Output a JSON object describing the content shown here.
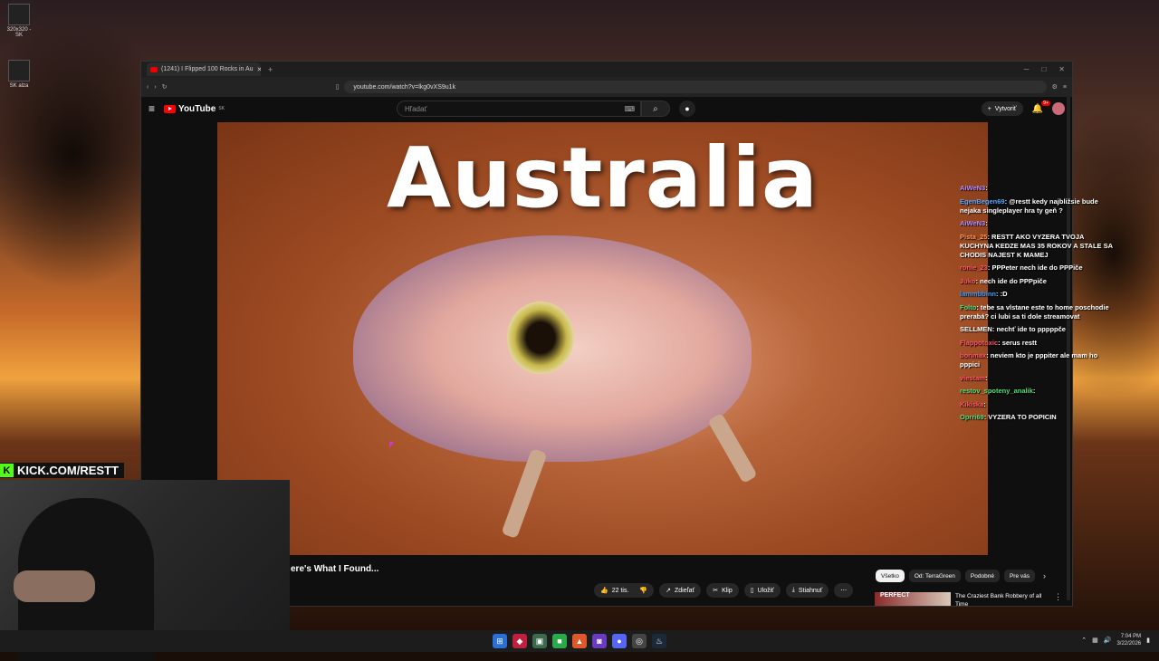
{
  "desktop": {
    "icons": [
      {
        "label": "320x320 - SK",
        "icon": "app-icon"
      },
      {
        "label": "SK alza",
        "icon": "app-icon"
      }
    ]
  },
  "browser": {
    "tab_title": "(1241) I Flipped 100 Rocks in Au",
    "url": "youtube.com/watch?v=lkg0vXS9u1k"
  },
  "youtube": {
    "logo": "YouTube",
    "country": "SK",
    "search_placeholder": "Hľadať",
    "create_label": "Vytvoriť",
    "notifications": "9+",
    "video_overlay_title": "Australia",
    "video_heading": "ere's What I Found...",
    "actions": {
      "like": "22 tis.",
      "share": "Zdieľať",
      "clip": "Klip",
      "save": "Uložiť",
      "download": "Stiahnuť"
    },
    "chips": [
      "Všetko",
      "Od: TerraGreen",
      "Podobné",
      "Pre vás"
    ],
    "recommended": [
      {
        "thumb_text": "PERFECT",
        "title": "The Craziest Bank Robbery of all Time"
      }
    ]
  },
  "chat": [
    {
      "user": "AiWeN3",
      "text": "",
      "color": "#b38cff"
    },
    {
      "user": "EgenBegen69",
      "text": "@restt kedy najbližsie bude nejaka singleplayer hra ty geň ?",
      "color": "#58a6ff"
    },
    {
      "user": "AiWeN3",
      "text": "",
      "color": "#b38cff"
    },
    {
      "user": "Pista_25",
      "text": "RESTT AKO VYZERA TVOJA KUCHYNA KEDZE MAS 35 ROKOV A STALE SA CHODIS NAJEST K MAMEJ",
      "color": "#ff9955"
    },
    {
      "user": "ronie_23",
      "text": "PPPeter nech ide do PPPiče",
      "color": "#ff5566"
    },
    {
      "user": "Juko",
      "text": "nech ide do PPPpiče",
      "color": "#ff5566"
    },
    {
      "user": "lammbbinn",
      "text": ":D",
      "color": "#3399ff"
    },
    {
      "user": "Folto",
      "text": "tebe sa vlstane este to home poschodie prerabá? ci lubi sa ti dole streamovat",
      "color": "#55dd77"
    },
    {
      "user": "SELLMEN",
      "text": "nechť ide to pppppče",
      "color": "#ffffff"
    },
    {
      "user": "Flappotoxic",
      "text": "serus restt",
      "color": "#ff5566"
    },
    {
      "user": "borimax",
      "text": "neviem kto je pppiter ale mam ho pppici",
      "color": "#ff5566"
    },
    {
      "user": "viestam",
      "text": "",
      "color": "#ff5566"
    },
    {
      "user": "restov_spoteny_analik",
      "text": "",
      "color": "#55dd77"
    },
    {
      "user": "Kikiska",
      "text": "",
      "color": "#ff5566"
    },
    {
      "user": "Oprri69",
      "text": "VYZERA TO POPICIN",
      "color": "#55dd77"
    }
  ],
  "stream_overlay": {
    "kick_url": "KICK.COM/RESTT"
  },
  "taskbar": {
    "time": "7:04 PM",
    "date": "3/22/2026"
  }
}
